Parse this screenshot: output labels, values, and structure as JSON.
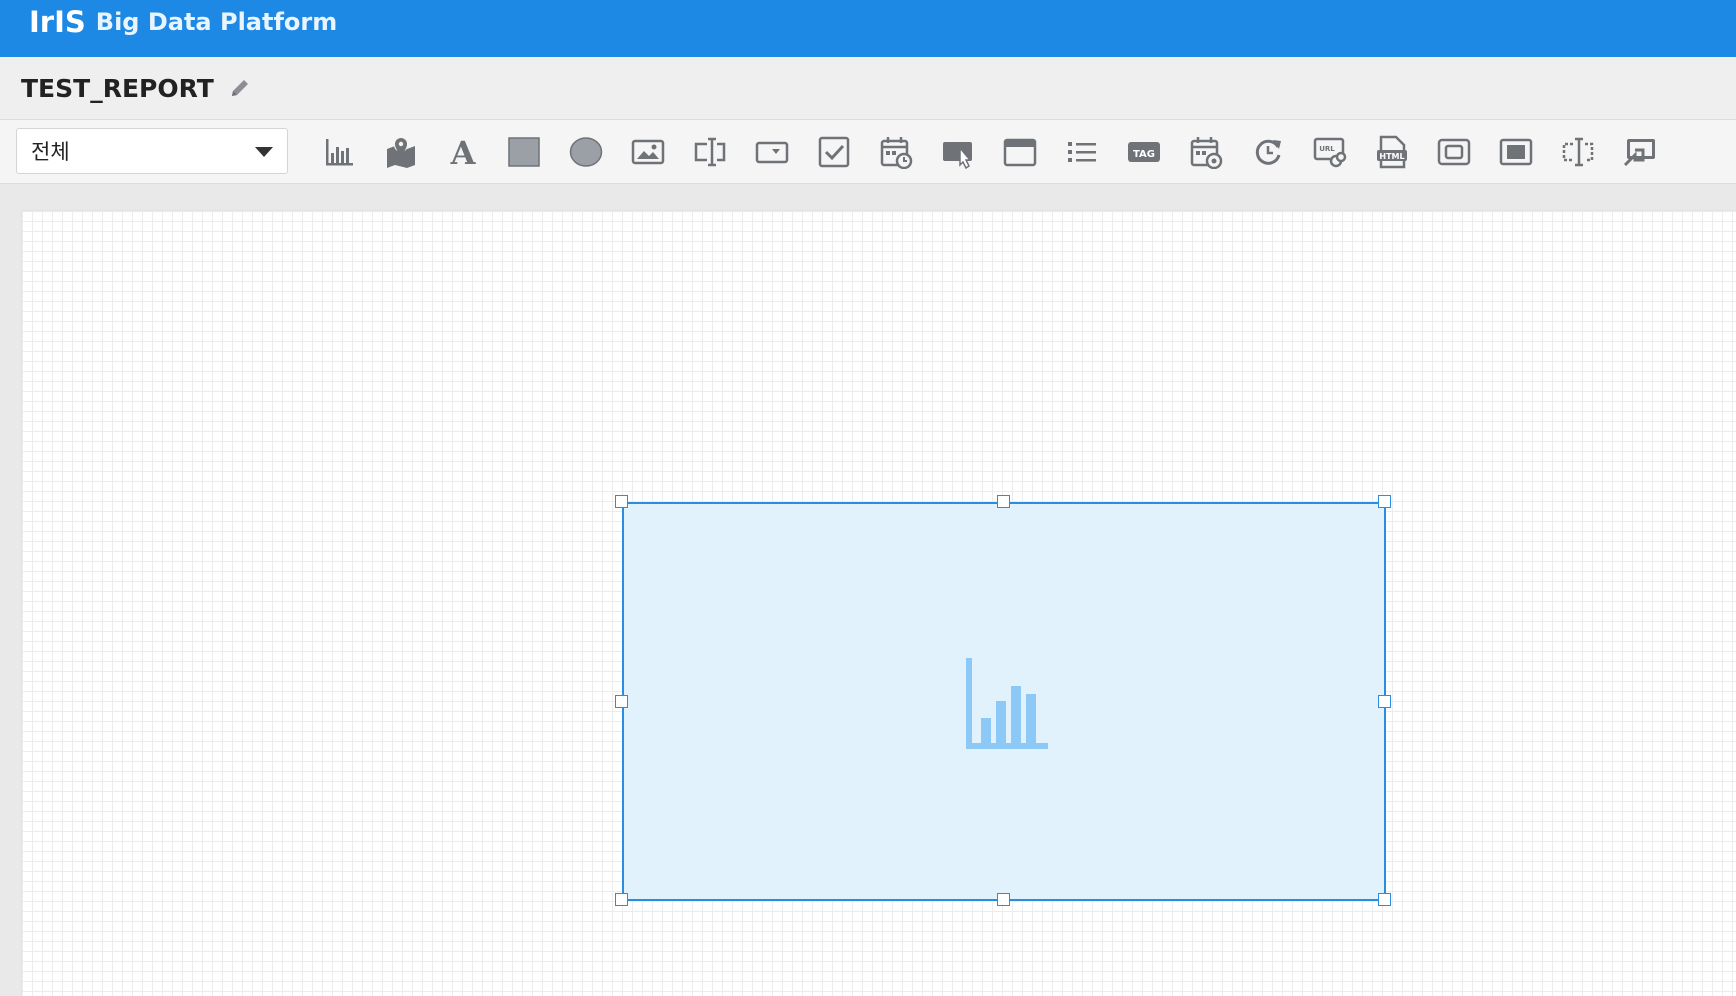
{
  "header": {
    "logo_text": "IrIS",
    "app_name": "Big Data Platform",
    "bar_color": "#1e88e5"
  },
  "report": {
    "title": "TEST_REPORT",
    "edit_icon": "pencil-icon"
  },
  "toolbar": {
    "category_select": {
      "selected": "전체"
    },
    "tools": [
      {
        "icon": "bar-chart-icon"
      },
      {
        "icon": "map-icon"
      },
      {
        "icon": "text-icon"
      },
      {
        "icon": "rectangle-icon"
      },
      {
        "icon": "ellipse-icon"
      },
      {
        "icon": "image-icon"
      },
      {
        "icon": "text-input-icon"
      },
      {
        "icon": "dropdown-icon"
      },
      {
        "icon": "checkbox-icon"
      },
      {
        "icon": "calendar-time-icon"
      },
      {
        "icon": "button-click-icon"
      },
      {
        "icon": "window-icon"
      },
      {
        "icon": "list-icon"
      },
      {
        "icon": "tag-icon",
        "label": "TAG"
      },
      {
        "icon": "calendar-settings-icon"
      },
      {
        "icon": "refresh-icon"
      },
      {
        "icon": "url-link-icon",
        "label": "URL"
      },
      {
        "icon": "html-file-icon",
        "label": "HTML"
      },
      {
        "icon": "frame-icon"
      },
      {
        "icon": "panel-icon"
      },
      {
        "icon": "cursor-input-icon"
      },
      {
        "icon": "screen-share-icon"
      }
    ]
  },
  "canvas": {
    "widget": {
      "type_icon": "bar-chart-icon",
      "fill_color": "#e1f2fd",
      "border_color": "#2a8de0"
    }
  }
}
